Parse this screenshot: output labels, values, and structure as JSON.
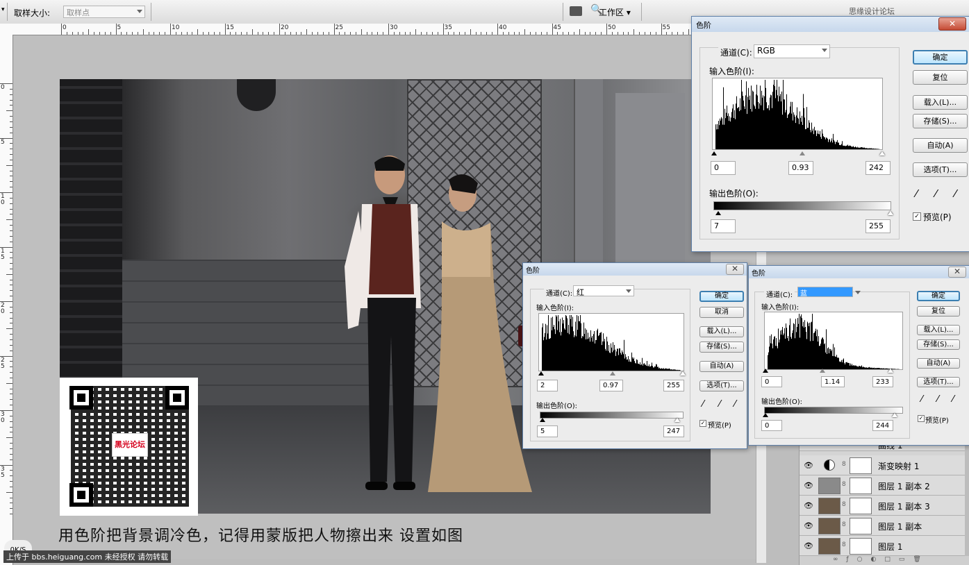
{
  "options_bar": {
    "sample_size_label": "取样大小:",
    "sample_size_value": "取样点",
    "workspace_label": "工作区",
    "watermark_site": "思缘设计论坛 www.MISSYUAN.COM"
  },
  "ruler": {
    "h_ticks": [
      "0",
      "5",
      "10",
      "15",
      "20",
      "25",
      "30",
      "35",
      "40",
      "45",
      "50",
      "55"
    ],
    "v_ticks": [
      "0",
      "5",
      "1 0",
      "1 5",
      "2 0",
      "2 5",
      "3 0",
      "3 5"
    ]
  },
  "canvas": {
    "caption": "用色阶把背景调冷色，记得用蒙版把人物擦出来 设置如图",
    "watermark": "上传于 bbs.heiguang.com 未经授权 请勿转载",
    "zoom_status": "0K/S",
    "qr_logo": "黑光论坛"
  },
  "dialogs": [
    {
      "title": "色阶",
      "channel_label": "通道(C):",
      "channel_value": "RGB",
      "input_label": "输入色阶(I):",
      "input_values": [
        "0",
        "0.93",
        "242"
      ],
      "output_label": "输出色阶(O):",
      "output_values": [
        "7",
        "255"
      ],
      "buttons": [
        "确定",
        "复位",
        "载入(L)...",
        "存储(S)...",
        "自动(A)",
        "选项(T)..."
      ],
      "preview_label": "预览(P)",
      "close": "✕"
    },
    {
      "title": "色阶",
      "channel_label": "通道(C):",
      "channel_value": "红",
      "input_label": "输入色阶(I):",
      "input_values": [
        "2",
        "0.97",
        "255"
      ],
      "output_label": "输出色阶(O):",
      "output_values": [
        "5",
        "247"
      ],
      "buttons": [
        "确定",
        "取消",
        "载入(L)...",
        "存储(S)...",
        "自动(A)",
        "选项(T)..."
      ],
      "preview_label": "预览(P)",
      "close": "✕"
    },
    {
      "title": "色阶",
      "channel_label": "通道(C):",
      "channel_value": "蓝",
      "input_label": "输入色阶(I):",
      "input_values": [
        "0",
        "1.14",
        "233"
      ],
      "output_label": "输出色阶(O):",
      "output_values": [
        "0",
        "244"
      ],
      "buttons": [
        "确定",
        "复位",
        "载入(L)...",
        "存储(S)...",
        "自动(A)",
        "选项(T)..."
      ],
      "preview_label": "预览(P)",
      "close": "✕"
    }
  ],
  "layers": [
    {
      "name": "曲线 1"
    },
    {
      "name": "渐变映射 1"
    },
    {
      "name": "图层 1 副本 2"
    },
    {
      "name": "图层 1 副本 3"
    },
    {
      "name": "图层 1 副本"
    },
    {
      "name": "图层 1"
    }
  ],
  "colors": {
    "accent_blue": "#3c7fb1",
    "close_red": "#c44a34",
    "selection_blue": "#3399ff"
  }
}
